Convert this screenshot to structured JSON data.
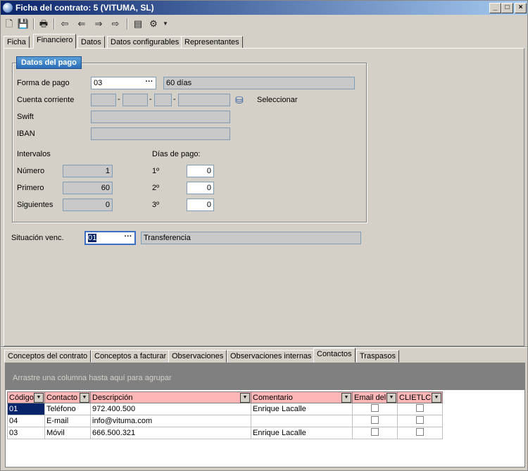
{
  "window": {
    "title": "Ficha del contrato: 5 (VITUMA, SL)",
    "controls": {
      "minimize": "_",
      "maximize": "□",
      "close": "×"
    }
  },
  "toolbar": {
    "icons": [
      "new-document-icon",
      "save-icon",
      "print-icon",
      "first-record-icon",
      "previous-record-icon",
      "next-record-icon",
      "last-record-icon",
      "report-icon",
      "tools-icon",
      "dropdown-arrow-icon"
    ]
  },
  "top_tabs": [
    {
      "label": "Ficha"
    },
    {
      "label": "Financiero",
      "active": true
    },
    {
      "label": "Datos"
    },
    {
      "label": "Datos configurables"
    },
    {
      "label": "Representantes"
    }
  ],
  "payment": {
    "group_title": "Datos del pago",
    "forma_pago": {
      "label": "Forma de pago",
      "code": "03",
      "description": "60 días",
      "lookup": "···"
    },
    "cuenta": {
      "label": "Cuenta corriente",
      "part1": "",
      "part2": "",
      "part3": "",
      "part4": "",
      "sep": "-",
      "select_label": "Seleccionar"
    },
    "swift": {
      "label": "Swift",
      "value": ""
    },
    "iban": {
      "label": "IBAN",
      "value": ""
    },
    "intervalos": {
      "label": "Intervalos",
      "numero": {
        "label": "Número",
        "value": "1"
      },
      "primero": {
        "label": "Primero",
        "value": "60"
      },
      "siguientes": {
        "label": "Siguientes",
        "value": "0"
      }
    },
    "dias_pago": {
      "label": "Días de pago:",
      "d1": {
        "label": "1º",
        "value": "0"
      },
      "d2": {
        "label": "2º",
        "value": "0"
      },
      "d3": {
        "label": "3º",
        "value": "0"
      }
    }
  },
  "situacion": {
    "label": "Situación venc.",
    "code": "01",
    "description": "Transferencia",
    "lookup": "···"
  },
  "bottom_tabs": [
    {
      "label": "Conceptos del contrato"
    },
    {
      "label": "Conceptos a facturar"
    },
    {
      "label": "Observaciones"
    },
    {
      "label": "Observaciones internas"
    },
    {
      "label": "Contactos",
      "active": true
    },
    {
      "label": "Traspasos"
    }
  ],
  "grid": {
    "group_hint": "Arrastre una columna hasta aquí para agrupar",
    "columns": [
      "Código",
      "Contacto",
      "Descripción",
      "Comentario",
      "Email del",
      "CLIETLC"
    ],
    "rows": [
      {
        "codigo": "01",
        "contacto": "Teléfono",
        "descripcion": "972.400.500",
        "comentario": "Enrique Lacalle"
      },
      {
        "codigo": "04",
        "contacto": "E-mail",
        "descripcion": "info@vituma.com",
        "comentario": ""
      },
      {
        "codigo": "03",
        "contacto": "Móvil",
        "descripcion": "666.500.321",
        "comentario": "Enrique Lacalle"
      }
    ]
  }
}
